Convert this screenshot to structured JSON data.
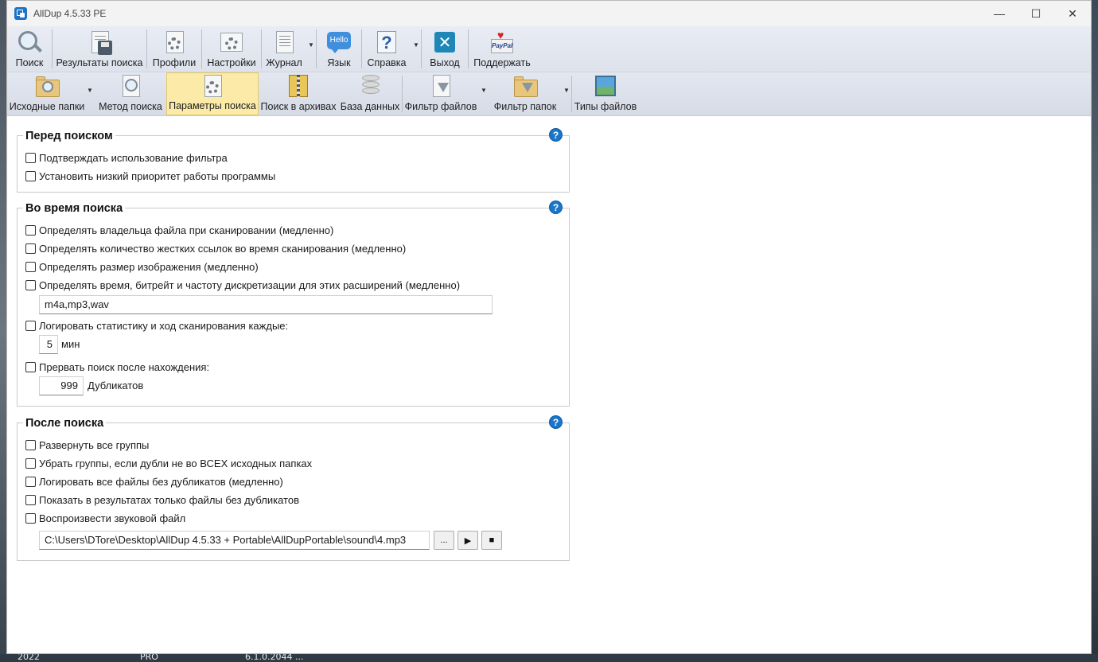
{
  "window": {
    "title": "AllDup 4.5.33 PE"
  },
  "titlebar_controls": {
    "minimize": "—",
    "maximize": "☐",
    "close": "✕"
  },
  "toolbar1": {
    "search": "Поиск",
    "results": "Результаты поиска",
    "profiles": "Профили",
    "settings": "Настройки",
    "journal": "Журнал",
    "language": "Язык",
    "language_icon_text": "Hello",
    "help": "Справка",
    "exit": "Выход",
    "support": "Поддержать",
    "support_icon_text": "PayPal"
  },
  "toolbar2": {
    "source_folders": "Исходные папки",
    "search_method": "Метод поиска",
    "search_params": "Параметры поиска",
    "search_archives": "Поиск в архивах",
    "database": "База данных",
    "file_filter": "Фильтр файлов",
    "folder_filter": "Фильтр папок",
    "file_types": "Типы файлов"
  },
  "before": {
    "title": "Перед поиском",
    "confirm_filter": "Подтверждать использование фильтра",
    "low_priority": "Установить низкий приоритет работы программы"
  },
  "during": {
    "title": "Во время поиска",
    "owner": "Определять владельца файла при сканировании (медленно)",
    "hardlinks": "Определять количество жестких ссылок во время сканирования (медленно)",
    "image_size": "Определять размер изображения (медленно)",
    "audio_info": "Определять время, битрейт и частоту дискретизации для этих расширений (медленно)",
    "extensions": "m4a,mp3,wav",
    "log_stats": "Логировать статистику и ход сканирования каждые:",
    "log_interval": "5",
    "log_unit": "мин",
    "stop_after": "Прервать поиск после нахождения:",
    "stop_count": "999",
    "stop_unit": "Дубликатов"
  },
  "after": {
    "title": "После поиска",
    "expand_groups": "Развернуть все группы",
    "remove_groups": "Убрать группы, если дубли не во ВСЕХ исходных папках",
    "log_no_dups": "Логировать все файлы без дубликатов (медленно)",
    "show_no_dups": "Показать в результатах только файлы без дубликатов",
    "play_sound": "Воспроизвести звуковой файл",
    "sound_path": "C:\\Users\\DTore\\Desktop\\AllDup 4.5.33 + Portable\\AllDupPortable\\sound\\4.mp3",
    "browse": "...",
    "play": "▶",
    "stop": "■"
  },
  "help_mark": "?",
  "desktop": {
    "t1": "2022",
    "t2": "PRO",
    "t3": "6.1.0.2044 ..."
  }
}
